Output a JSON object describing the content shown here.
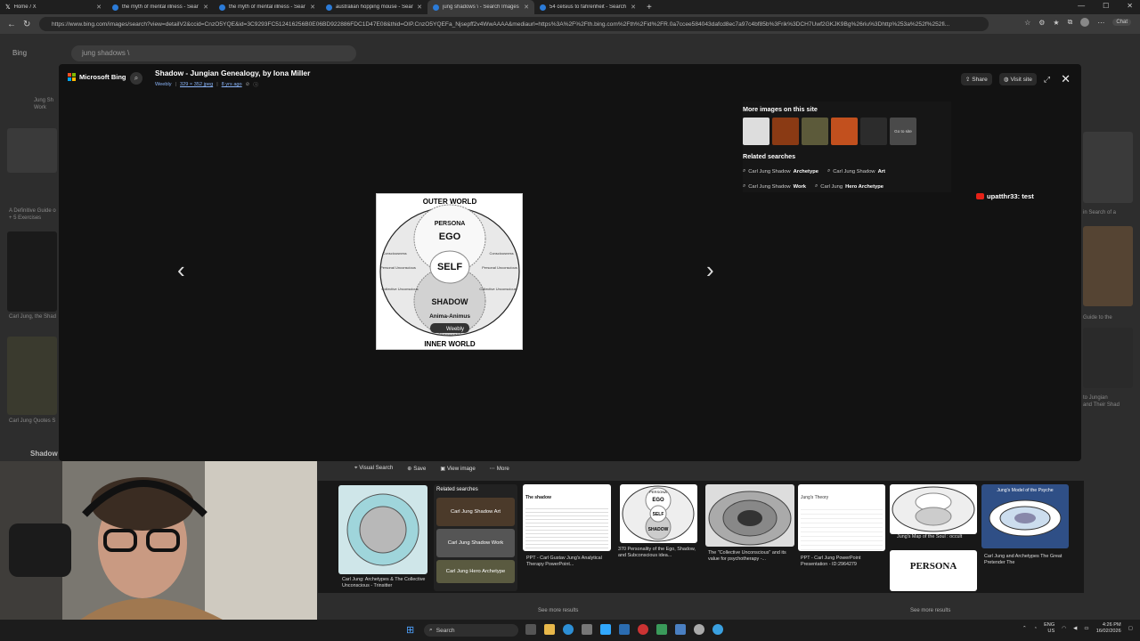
{
  "browser": {
    "tabs": [
      {
        "title": "Home / X"
      },
      {
        "title": "the myth of mental illness - Sear"
      },
      {
        "title": "the myth of mental illness - Sear"
      },
      {
        "title": "australian hopping mouse - Sear"
      },
      {
        "title": "jung shadows \\ - Search Images"
      },
      {
        "title": "54 celsius to fahrenheit - Search"
      }
    ],
    "url": "https://www.bing.com/images/search?view=detailV2&ccid=CnzO5YQE&id=3C9293FC512416256B0E06BD922886FDC1D47E08&thid=OIP.CnzO5YQEFa_Njsepff2v4WwAAAA&mediaurl=https%3A%2F%2Fth.bing.com%2Fth%2Fid%2FR.0a7ccee584043dafcd8ec7a97c4bf85b%3Frik%3DCH7Uwf2GKJK9Bg%26riu%3Dhttp%253a%252f%252fi...",
    "chat_label": "Chat"
  },
  "background_page": {
    "logo": "Bing",
    "search_value": "jung shadows \\",
    "left_texts": [
      "Jung Sh",
      "Work",
      "A Definitive Guide o",
      "+ 5 Exercises",
      "Carl Jung, the Shad",
      "Carl Jung Quotes S",
      "Shadow"
    ],
    "right_texts": [
      "in Search of a",
      "Guide to the",
      "to Jungian",
      "and Their Shad"
    ],
    "see_more_left": "See more results",
    "see_more_right": "See more results"
  },
  "modal": {
    "brand": "Microsoft Bing",
    "title": "Shadow - Jungian Genealogy, by Iona Miller",
    "meta": {
      "source": "Weebly",
      "size": "329 × 352 jpeg",
      "age": "8 yrs ago"
    },
    "actions": {
      "share": "Share",
      "visit": "Visit site"
    },
    "main_image": {
      "outer": "OUTER WORLD",
      "inner": "INNER WORLD",
      "persona": "PERSONA",
      "ego": "EGO",
      "self": "SELF",
      "shadow": "SHADOW",
      "anima": "Anima-Animus",
      "left_labels": [
        "Consciousness",
        "Personal Unconscious",
        "Collective Unconscious"
      ],
      "right_labels": [
        "Consciousness",
        "Personal Unconscious",
        "Collective Unconscious"
      ],
      "source_badge": "Weebly"
    },
    "more_images_title": "More images on this site",
    "go_to_site": "Go to site",
    "related_title": "Related searches",
    "related": [
      {
        "plain": "Carl Jung Shadow ",
        "bold": "Archetype"
      },
      {
        "plain": "Carl Jung Shadow ",
        "bold": "Art"
      },
      {
        "plain": "Carl Jung Shadow ",
        "bold": "Work"
      },
      {
        "plain": "Carl Jung ",
        "bold": "Hero Archetype"
      }
    ],
    "overlay_badge": "upatthr33: test",
    "action_bar": [
      "Visual Search",
      "Save",
      "View image",
      "More"
    ]
  },
  "results": {
    "related_box_title": "Related searches",
    "related_box_items": [
      "Carl Jung Shadow Art",
      "Carl Jung Shadow Work",
      "Carl Jung Hero Archetype"
    ],
    "captions": [
      "Carl Jung: Archetypes & The Collective Unconscious - Trinsitter",
      "PPT - Carl Gustav Jung's Analytical Therapy PowerPoint...",
      "370 Personality of the Ego, Shadow, and Subconscious idea...",
      "The \"Collective Unconscious\" and its value for psychotherapy -...",
      "PPT - Carl Jung PowerPoint Presentation - ID:2964279",
      "Jung's Map of the Soul : occult",
      "Carl Jung and Archetypes The Great Pretender The"
    ],
    "card_labels": {
      "shadow_card": "The shadow",
      "theory_card": "Jung's Theory",
      "model_card": "Jung's Model of the Psyche",
      "persona": "PERSONA",
      "ego": "EGO",
      "self": "SELF",
      "shadow": "SHADOW",
      "ego_small": "Ego",
      "shadow_small": "Shadow"
    }
  },
  "taskbar": {
    "search": "Search",
    "lang": "ENG",
    "region": "US",
    "time": "4:26 PM",
    "date": "16/02/2026"
  }
}
